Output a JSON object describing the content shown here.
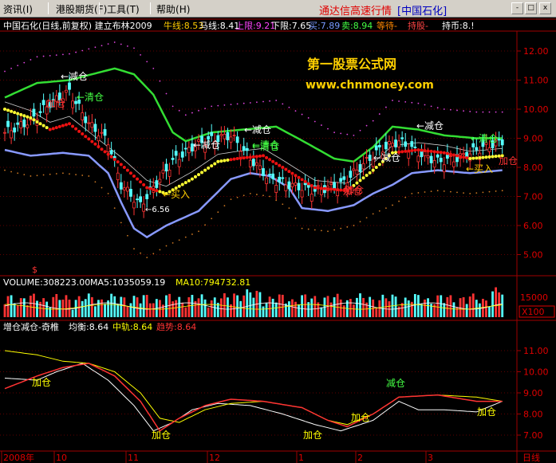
{
  "menu": [
    "资讯",
    "港股期货",
    "工具",
    "帮助"
  ],
  "menu_underlines": [
    "(I)",
    "(F)",
    "(T)",
    "(H)"
  ],
  "app_title": "通达信高速行情",
  "stock_tag": "[中国石化]",
  "window_icons": [
    "x",
    "□",
    "-"
  ],
  "main_header": {
    "prefix": "中国石化(日线,前复权) 建立布林2009",
    "items": [
      {
        "label": "牛线:8.53",
        "color": "#ffcc00"
      },
      {
        "label": "马线:8.41",
        "color": "#ffffff"
      },
      {
        "label": "上限:9.21",
        "color": "#ff44ff"
      },
      {
        "label": "下限:7.65",
        "color": "#ffffff"
      },
      {
        "label": "买:7.89",
        "color": "#7799ff"
      },
      {
        "label": "卖:8.94",
        "color": "#44ff44"
      },
      {
        "label": "等待-",
        "color": "#ff8800"
      },
      {
        "label": "持股-",
        "color": "#ff4444"
      },
      {
        "label": "持币:8.!",
        "color": "#ffffff"
      }
    ]
  },
  "watermark": {
    "line1": "第一股票公式网",
    "line2": "www.chnmoney.com",
    "color": "#ffd000"
  },
  "price_axis": [
    "12.00",
    "11.00",
    "10.00",
    "9.00",
    "8.00",
    "7.00",
    "6.00",
    "5.00"
  ],
  "price_annotations": [
    {
      "text": "减仓",
      "color": "#ffffff"
    },
    {
      "text": "清仓",
      "color": "#44ff44"
    },
    {
      "text": "加仓",
      "color": "#ff3333"
    },
    {
      "text": "减仓",
      "color": "#ffffff"
    },
    {
      "text": "清仓",
      "color": "#44ff44"
    },
    {
      "text": "买入",
      "color": "#ffd000"
    },
    {
      "text": "6.56",
      "color": "#ffffff"
    },
    {
      "text": "减仓",
      "color": "#ffffff"
    },
    {
      "text": "清仓",
      "color": "#44ff44"
    },
    {
      "text": "加仓",
      "color": "#ff3333"
    },
    {
      "text": "减仓",
      "color": "#ffffff"
    },
    {
      "text": "减仓",
      "color": "#ffffff"
    },
    {
      "text": "清仓",
      "color": "#44ff44"
    },
    {
      "text": "买入",
      "color": "#ffd000"
    },
    {
      "text": "加仓",
      "color": "#ff3333"
    },
    {
      "text": "加仓",
      "color": "#ff3333"
    }
  ],
  "dollar_mark": "$",
  "volume_header": [
    {
      "label": "VOLUME:308223.00",
      "color": "#ffffff"
    },
    {
      "label": "MA5:1035059.19",
      "color": "#ffffff"
    },
    {
      "label": "MA10:794732.81",
      "color": "#ffff00"
    }
  ],
  "volume_axis": [
    "15000"
  ],
  "volume_unit": "X100",
  "indicator_header": [
    {
      "label": "增仓减仓-奇椎",
      "color": "#ffffff"
    },
    {
      "label": "均衡:8.64",
      "color": "#ffffff"
    },
    {
      "label": "中轨:8.64",
      "color": "#ffff00"
    },
    {
      "label": "趋势:8.64",
      "color": "#ff3333"
    }
  ],
  "indicator_axis": [
    "11.00",
    "10.00",
    "9.00",
    "8.00",
    "7.00"
  ],
  "indicator_annotations": [
    {
      "text": "加仓",
      "color": "#ffff00"
    },
    {
      "text": "加仓",
      "color": "#ffff00"
    },
    {
      "text": "加仓",
      "color": "#ffff00"
    },
    {
      "text": "加仓",
      "color": "#ffff00"
    },
    {
      "text": "减仓",
      "color": "#44ff44"
    },
    {
      "text": "加仓",
      "color": "#ffff00"
    }
  ],
  "time_axis": [
    "2008年",
    "10",
    "11",
    "12",
    "1",
    "2",
    "3"
  ],
  "period_label": "日线"
}
